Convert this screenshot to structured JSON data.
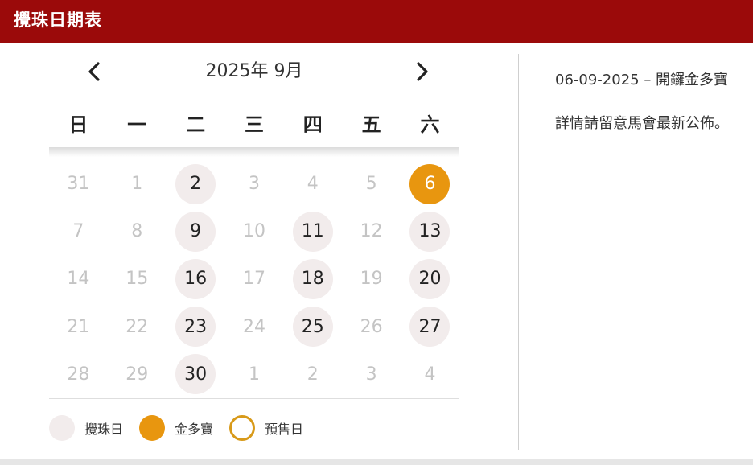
{
  "header": {
    "title": "攪珠日期表"
  },
  "calendar": {
    "month_title": "2025年 9月",
    "weekdays": [
      "日",
      "一",
      "二",
      "三",
      "四",
      "五",
      "六"
    ],
    "weeks": [
      [
        {
          "n": "31",
          "t": "other"
        },
        {
          "n": "1",
          "t": "cur"
        },
        {
          "n": "2",
          "t": "race"
        },
        {
          "n": "3",
          "t": "cur"
        },
        {
          "n": "4",
          "t": "cur"
        },
        {
          "n": "5",
          "t": "cur"
        },
        {
          "n": "6",
          "t": "jackpot"
        }
      ],
      [
        {
          "n": "7",
          "t": "cur"
        },
        {
          "n": "8",
          "t": "cur"
        },
        {
          "n": "9",
          "t": "race"
        },
        {
          "n": "10",
          "t": "cur"
        },
        {
          "n": "11",
          "t": "race"
        },
        {
          "n": "12",
          "t": "cur"
        },
        {
          "n": "13",
          "t": "race"
        }
      ],
      [
        {
          "n": "14",
          "t": "cur"
        },
        {
          "n": "15",
          "t": "cur"
        },
        {
          "n": "16",
          "t": "race"
        },
        {
          "n": "17",
          "t": "cur"
        },
        {
          "n": "18",
          "t": "race"
        },
        {
          "n": "19",
          "t": "cur"
        },
        {
          "n": "20",
          "t": "race"
        }
      ],
      [
        {
          "n": "21",
          "t": "cur"
        },
        {
          "n": "22",
          "t": "cur"
        },
        {
          "n": "23",
          "t": "race"
        },
        {
          "n": "24",
          "t": "cur"
        },
        {
          "n": "25",
          "t": "race"
        },
        {
          "n": "26",
          "t": "cur"
        },
        {
          "n": "27",
          "t": "race"
        }
      ],
      [
        {
          "n": "28",
          "t": "cur"
        },
        {
          "n": "29",
          "t": "cur"
        },
        {
          "n": "30",
          "t": "race"
        },
        {
          "n": "1",
          "t": "other"
        },
        {
          "n": "2",
          "t": "other"
        },
        {
          "n": "3",
          "t": "other"
        },
        {
          "n": "4",
          "t": "other"
        }
      ]
    ]
  },
  "legend": {
    "race_label": "攪珠日",
    "jackpot_label": "金多寶",
    "presale_label": "預售日"
  },
  "info": {
    "line1": "06-09-2025 – 開鑼金多寶",
    "line2": "詳情請留意馬會最新公佈。"
  },
  "icons": {
    "prev": "chevron-left-icon",
    "next": "chevron-right-icon"
  },
  "colors": {
    "header_bg": "#9b0a0a",
    "race_day": "#f2ecec",
    "jackpot_day": "#e8960f",
    "presale_ring": "#d89a1a"
  }
}
